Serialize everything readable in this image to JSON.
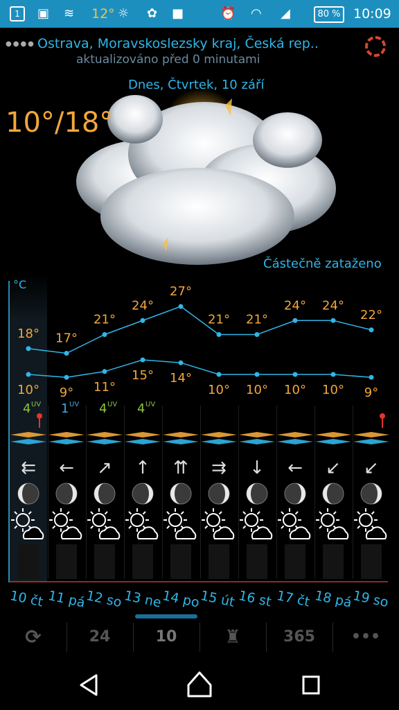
{
  "status_bar": {
    "calendar_day": "1",
    "temperature": "12°",
    "battery": "80 %",
    "time": "10:09"
  },
  "header": {
    "location": "Ostrava, Moravskoslezsky kraj, Česká rep..",
    "updated": "aktualizováno před 0 minutami",
    "date": "Dnes, Čtvrtek, 10 září",
    "hi_lo": "10°/18°",
    "condition": "Částečně zataženo"
  },
  "chart_data": {
    "type": "line",
    "ylabel": "°C",
    "categories": [
      "10 čt",
      "11 pá",
      "12 so",
      "13 ne",
      "14 po",
      "15 út",
      "16 st",
      "17 čt",
      "18 pá",
      "19 so"
    ],
    "series": [
      {
        "values": [
          18,
          17,
          21,
          24,
          27,
          21,
          21,
          24,
          24,
          22
        ]
      },
      {
        "values": [
          10,
          9,
          11,
          15,
          14,
          10,
          10,
          10,
          10,
          9
        ]
      }
    ],
    "uv": [
      "4",
      "1",
      "4",
      "4"
    ],
    "wind_icons": [
      "wind-arrows-left-icon",
      "arrow-left-icon",
      "arrow-up-right-icon",
      "arrow-up-icon",
      "arrows-up-icon",
      "wind-arrows-right-icon",
      "arrow-down-icon",
      "arrow-left-icon",
      "arrow-down-left-icon",
      "arrow-down-left-icon"
    ]
  },
  "toolbar": {
    "tab_24": "24",
    "tab_10": "10",
    "tab_365": "365",
    "more": "•••"
  },
  "colors": {
    "accent": "#2fb6e8",
    "temp": "#f3a73a",
    "uv": "#8dc63f",
    "status_bar": "#1d8fbf"
  }
}
